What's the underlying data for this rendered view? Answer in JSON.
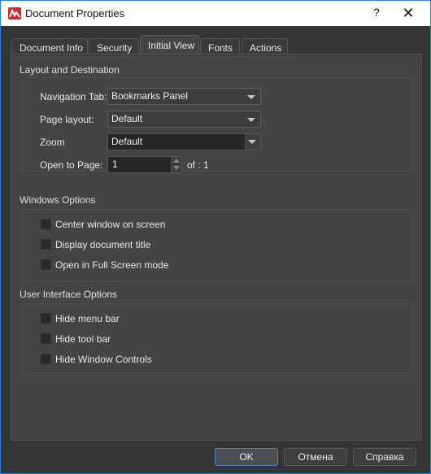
{
  "window": {
    "title": "Document Properties",
    "help_label": "?",
    "close_label": "✕",
    "icon": "app-logo-icon"
  },
  "tabs": [
    {
      "label": "Document Info",
      "active": false
    },
    {
      "label": "Security",
      "active": false
    },
    {
      "label": "Initial View",
      "active": true
    },
    {
      "label": "Fonts",
      "active": false
    },
    {
      "label": "Actions",
      "active": false
    }
  ],
  "layout_section": {
    "title": "Layout and Destination",
    "navigation_tab": {
      "label": "Navigation Tab:",
      "value": "Bookmarks Panel"
    },
    "page_layout": {
      "label": "Page layout:",
      "value": "Default"
    },
    "zoom": {
      "label": "Zoom",
      "value": "Default"
    },
    "open_to_page": {
      "label": "Open to Page:",
      "value": "1",
      "of_label": "of : 1"
    }
  },
  "windows_section": {
    "title": "Windows Options",
    "options": [
      {
        "label": "Center window on screen",
        "checked": false
      },
      {
        "label": "Display document title",
        "checked": false
      },
      {
        "label": "Open in Full Screen mode",
        "checked": false
      }
    ]
  },
  "ui_section": {
    "title": "User Interface Options",
    "options": [
      {
        "label": "Hide menu bar",
        "checked": false
      },
      {
        "label": "Hide tool bar",
        "checked": false
      },
      {
        "label": "Hide Window Controls",
        "checked": false
      }
    ]
  },
  "buttons": {
    "ok": "OK",
    "cancel": "Отмена",
    "help": "Справка"
  },
  "colors": {
    "accent": "#2b7fd2",
    "logo": "#d9262b"
  }
}
